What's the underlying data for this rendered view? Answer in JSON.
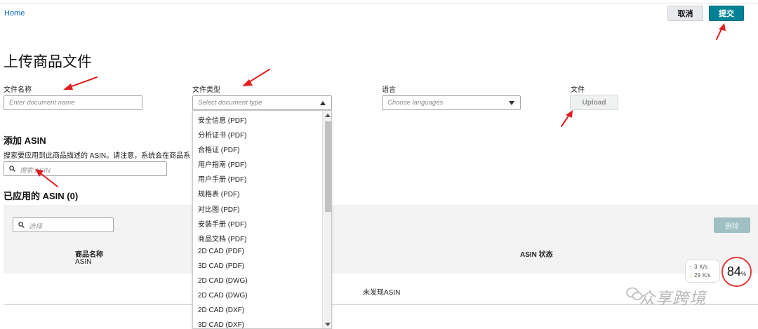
{
  "breadcrumb": "Home",
  "header": {
    "cancel_label": "取消",
    "submit_label": "提交"
  },
  "page_title": "上传商品文件",
  "form": {
    "doc_name": {
      "label": "文件名称",
      "placeholder": "Enter document name"
    },
    "doc_type": {
      "label": "文件类型",
      "placeholder": "Select document type"
    },
    "language": {
      "label": "语言",
      "placeholder": "Choose languages"
    },
    "file": {
      "label": "文件",
      "upload_label": "Upload"
    }
  },
  "dropdown": {
    "options": [
      "安全信息 (PDF)",
      "分析证书 (PDF)",
      "合格证 (PDF)",
      "用户指南 (PDF)",
      "用户手册 (PDF)",
      "规格表 (PDF)",
      "对比图 (PDF)",
      "安装手册 (PDF)",
      "商品文档 (PDF)",
      "2D CAD (PDF)",
      "3D CAD (PDF)",
      "2D CAD (DWG)",
      "2D CAD (DWG)",
      "2D CAD (DXF)",
      "3D CAD (DXF)"
    ]
  },
  "add_asin": {
    "title": "添加 ASIN",
    "description": "搜索要应用到此商品描述的 ASIN。请注意，系统会在商品系",
    "search_placeholder": "搜索 ASIN"
  },
  "applied_asin": {
    "title": "已应用的 ASIN (0)",
    "filter_placeholder": "选择",
    "remove_label": "删除",
    "col_product_name": "商品名称",
    "col_asin": "ASIN",
    "col_status": "ASIN 状态",
    "empty_message": "未发现ASIN"
  },
  "speed_widget": {
    "up": "3",
    "down": "29",
    "unit": "K/s",
    "percent": "84",
    "percent_unit": "%"
  },
  "watermark": "众享跨境",
  "colors": {
    "accent": "#008296",
    "link": "#0066c0",
    "arrow": "#e02020"
  }
}
